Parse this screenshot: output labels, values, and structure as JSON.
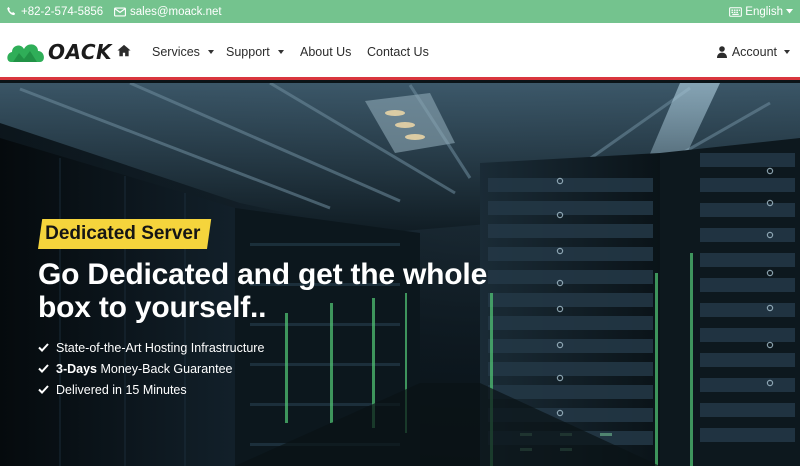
{
  "topbar": {
    "phone": "+82-2-574-5856",
    "email": "sales@moack.net",
    "language": "English",
    "icons": [
      "phone-icon",
      "mail-icon",
      "keyboard-icon",
      "chevron-down-icon"
    ]
  },
  "nav": {
    "logo_text": "OACK",
    "items": [
      {
        "label": "Services",
        "dropdown": true
      },
      {
        "label": "Support",
        "dropdown": true
      },
      {
        "label": "About Us",
        "dropdown": false
      },
      {
        "label": "Contact Us",
        "dropdown": false
      }
    ],
    "account_label": "Account"
  },
  "hero": {
    "badge": "Dedicated Server",
    "headline_line1": "Go Dedicated and get the whole",
    "headline_line2": "box to yourself..",
    "features": [
      {
        "bold": "",
        "text": "State-of-the-Art Hosting Infrastructure"
      },
      {
        "bold": "3-Days",
        "text": " Money-Back Guarantee"
      },
      {
        "bold": "",
        "text": "Delivered in 15 Minutes"
      }
    ]
  },
  "colors": {
    "topbar": "#74c38e",
    "accent_line": "#d9363e",
    "badge": "#f5d43c",
    "logo_green": "#2fae58"
  }
}
